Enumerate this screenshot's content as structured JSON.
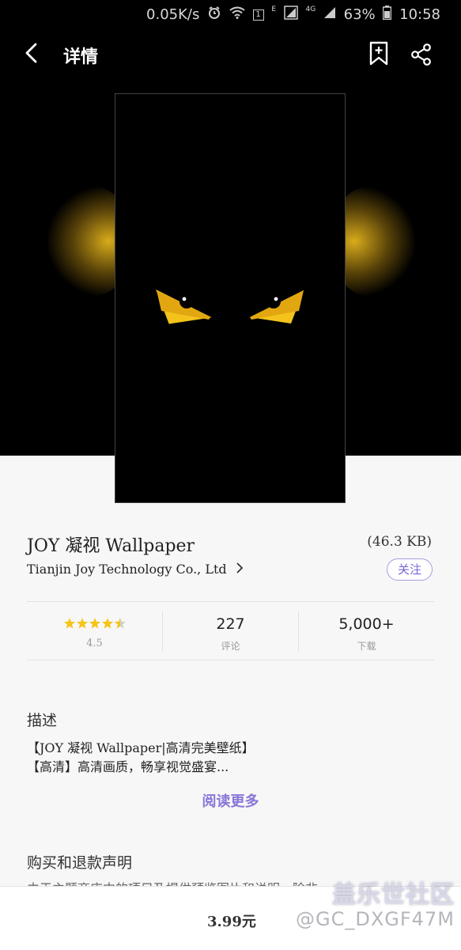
{
  "status_bar": {
    "network_speed": "0.05K/s",
    "sim_badge": "1",
    "edge_label": "E",
    "lte_label": "4G",
    "battery": "63%",
    "time": "10:58",
    "icons": [
      "alarm-icon",
      "wifi-icon",
      "sim-icon",
      "signal-icon",
      "signal-icon",
      "battery-icon"
    ]
  },
  "header": {
    "title": "详情",
    "icons": [
      "back-arrow-icon",
      "bookmark-add-icon",
      "share-icon"
    ]
  },
  "app": {
    "name": "JOY 凝视 Wallpaper",
    "size": "(46.3 KB)",
    "developer": "Tianjin Joy Technology Co., Ltd",
    "follow_label": "关注"
  },
  "stats": {
    "rating": "4.5",
    "rating_stars": 4.5,
    "reviews_value": "227",
    "reviews_label": "评论",
    "downloads_value": "5,000+",
    "downloads_label": "下载"
  },
  "description": {
    "heading": "描述",
    "lines": [
      "【JOY 凝视 Wallpaper|高清完美壁纸】",
      "【高清】高清画质，畅享视觉盛宴..."
    ],
    "read_more": "阅读更多"
  },
  "refund": {
    "heading": "购买和退款声明",
    "text": "由于主题商店中的项目及提供预览图片和说明，除非..."
  },
  "bottom_bar": {
    "price": "3.99元"
  },
  "watermark": {
    "line1": "盖乐世社区",
    "line2": "@GC_DXGF47M"
  },
  "colors": {
    "accent": "#7a64d6",
    "star": "#f5c518",
    "eye_yellow": "#f3c31c",
    "hero_bg": "#000000"
  }
}
